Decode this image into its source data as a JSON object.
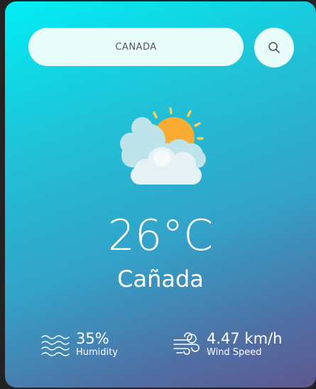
{
  "search": {
    "value": "CANADA"
  },
  "weather": {
    "icon": "partly-cloudy-icon",
    "temperature": "26°C",
    "city": "Cañada"
  },
  "details": {
    "humidity": {
      "value": "35%",
      "label": "Humidity",
      "icon": "waves-icon"
    },
    "wind": {
      "value": "4.47 km/h",
      "label": "Wind Speed",
      "icon": "wind-icon"
    }
  },
  "colors": {
    "gradient_start": "#00eef4",
    "gradient_end": "#5e5790",
    "input_bg": "#e8fdfa"
  }
}
